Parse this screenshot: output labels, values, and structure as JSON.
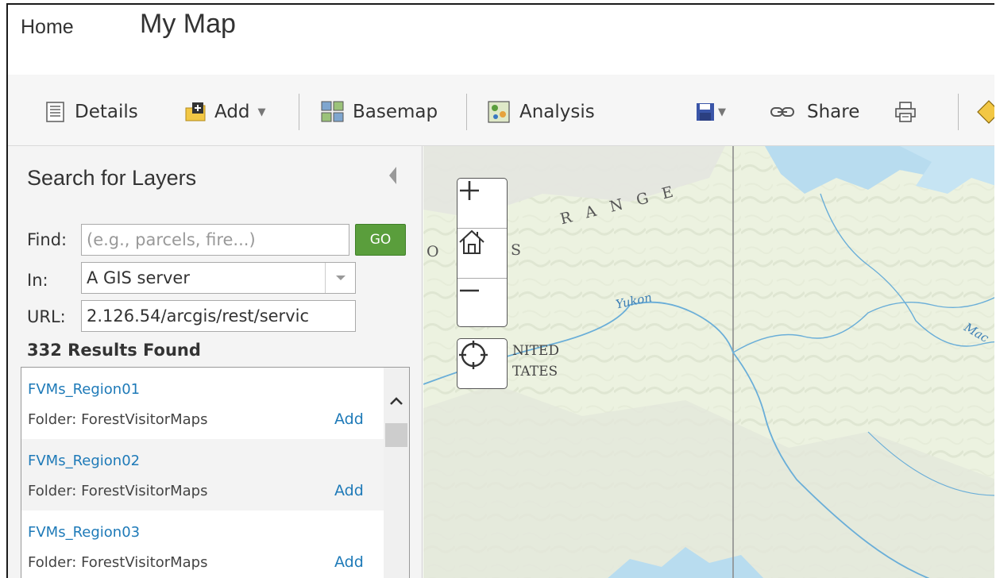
{
  "header": {
    "home_label": "Home",
    "map_title": "My Map"
  },
  "toolbar": {
    "details_label": "Details",
    "add_label": "Add",
    "basemap_label": "Basemap",
    "analysis_label": "Analysis",
    "share_label": "Share"
  },
  "search_panel": {
    "title": "Search for Layers",
    "find_label": "Find:",
    "find_placeholder": "(e.g., parcels, fire...)",
    "go_label": "GO",
    "in_label": "In:",
    "in_value": "A GIS server",
    "url_label": "URL:",
    "url_value": "2.126.54/arcgis/rest/servic",
    "results_count": "332 Results Found",
    "results": [
      {
        "name": "FVMs_Region01",
        "folder": "Folder: ForestVisitorMaps",
        "add_label": "Add"
      },
      {
        "name": "FVMs_Region02",
        "folder": "Folder: ForestVisitorMaps",
        "add_label": "Add"
      },
      {
        "name": "FVMs_Region03",
        "folder": "Folder: ForestVisitorMaps",
        "add_label": "Add"
      }
    ]
  },
  "map": {
    "labels": {
      "range_left": "O",
      "range_mid": "S",
      "range_right": "R A N G E",
      "river_yukon": "Yukon",
      "country_line1": "NITED",
      "country_line2": "TATES",
      "river_right": "Mac"
    }
  },
  "colors": {
    "accent_link": "#1e7ab8",
    "go_button": "#5a9e3c",
    "save_icon": "#3a55a8",
    "map_land": "#ecf2e0",
    "map_water": "#b8dcef"
  }
}
